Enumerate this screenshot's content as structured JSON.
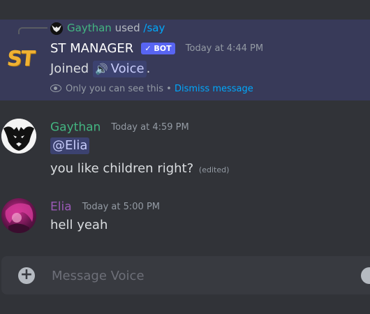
{
  "ephemeral_message": {
    "reply": {
      "author": "Gaythan",
      "verb": "used",
      "command": "/say"
    },
    "bot": {
      "avatar_text": "ST",
      "name": "ST MANAGER",
      "badge": "✓ BOT",
      "timestamp": "Today at 4:44 PM"
    },
    "content": {
      "prefix": "Joined",
      "channel_name": "Voice",
      "suffix": "."
    },
    "note": {
      "text": "Only you can see this •",
      "dismiss_label": "Dismiss message"
    }
  },
  "messages": [
    {
      "author": "Gaythan",
      "timestamp": "Today at 4:59 PM",
      "mention": "@Elia",
      "text": "you like children right?",
      "edited_label": "(edited)"
    },
    {
      "author": "Elia",
      "timestamp": "Today at 5:00 PM",
      "text": "hell yeah"
    }
  ],
  "composer": {
    "placeholder": "Message Voice"
  },
  "colors": {
    "background": "#313338",
    "ephemeral_bg": "#383a59",
    "gaythan_name": "#43b581",
    "elia_name": "#9b59b6",
    "link": "#00a8fc",
    "bot_badge": "#5865f2"
  },
  "icons": [
    "speaker-icon",
    "eye-icon",
    "add-attachment-icon",
    "emoji-icon"
  ]
}
